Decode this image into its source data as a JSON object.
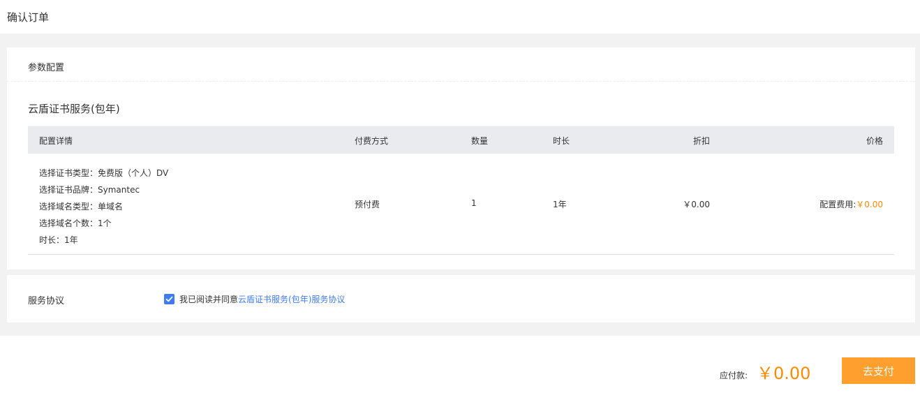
{
  "header": {
    "title": "确认订单"
  },
  "config_section": {
    "title": "参数配置",
    "product_name": "云盾证书服务(包年)",
    "table": {
      "headers": [
        "配置详情",
        "付费方式",
        "数量",
        "时长",
        "折扣",
        "价格"
      ],
      "row": {
        "details": [
          "选择证书类型：免费版（个人）DV",
          "选择证书品牌：Symantec",
          "选择域名类型：单域名",
          "选择域名个数：1个",
          "时长：1年"
        ],
        "payment_method": "预付费",
        "quantity": "1",
        "duration": "1年",
        "discount": "￥0.00",
        "price_label": "配置费用:",
        "price_value": "￥0.00"
      }
    }
  },
  "agreement": {
    "label": "服务协议",
    "checked": true,
    "text": "我已阅读并同意",
    "link_text": "云盾证书服务(包年)服务协议"
  },
  "footer": {
    "due_label": "应付款:",
    "due_amount": "￥0.00",
    "pay_button": "去支付"
  },
  "colors": {
    "accent": "#ff8a00",
    "pay_button": "#ff9f2d",
    "link": "#3f7cef",
    "checkbox": "#3f7cef",
    "table_header": "#e9ebef"
  }
}
